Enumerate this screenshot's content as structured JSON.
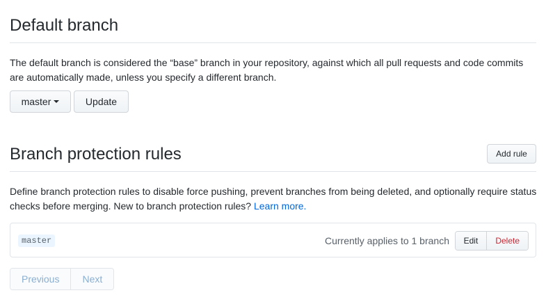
{
  "default_branch": {
    "title": "Default branch",
    "description": "The default branch is considered the “base” branch in your repository, against which all pull requests and code commits are automatically made, unless you specify a different branch.",
    "branch_select_label": "master",
    "update_label": "Update"
  },
  "branch_protection": {
    "title": "Branch protection rules",
    "add_rule_label": "Add rule",
    "description": "Define branch protection rules to disable force pushing, prevent branches from being deleted, and optionally require status checks before merging. New to branch protection rules?",
    "learn_more_label": "Learn more.",
    "rules": [
      {
        "pattern": "master",
        "applies_text": "Currently applies to 1 branch",
        "edit_label": "Edit",
        "delete_label": "Delete"
      }
    ]
  },
  "pagination": {
    "previous_label": "Previous",
    "next_label": "Next"
  },
  "colors": {
    "link": "#0366d6",
    "danger": "#cb2431",
    "disabled_text": "#8aaed1"
  }
}
